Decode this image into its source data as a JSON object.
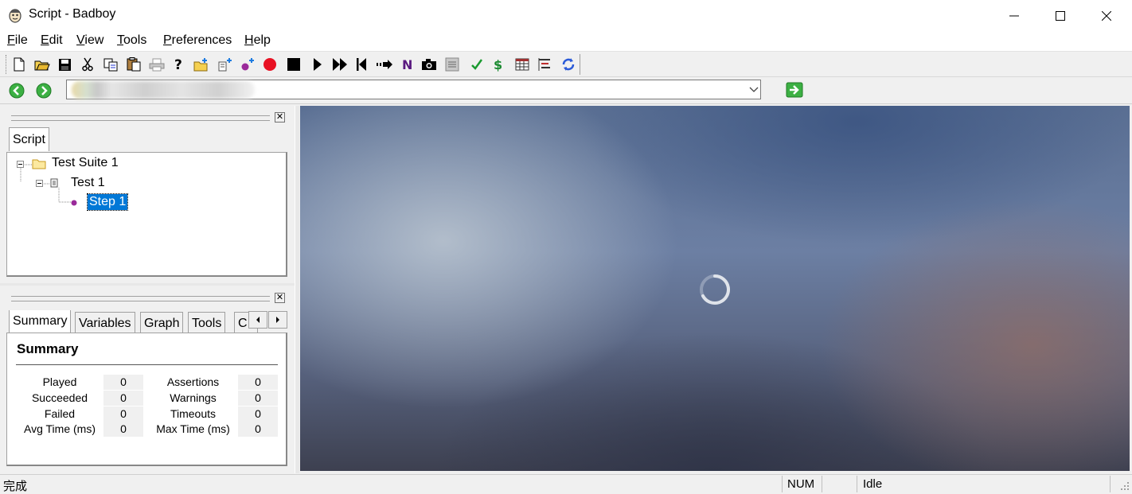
{
  "window": {
    "title": "Script - Badboy",
    "min_glyph": "—",
    "max_glyph": "☐",
    "close_glyph": "✕"
  },
  "menu": [
    {
      "key": "F",
      "rest": "ile"
    },
    {
      "key": "E",
      "rest": "dit"
    },
    {
      "key": "V",
      "rest": "iew"
    },
    {
      "key": "T",
      "rest": "ools"
    },
    {
      "key": "P",
      "rest": "references"
    },
    {
      "key": "H",
      "rest": "elp"
    }
  ],
  "toolbar": {
    "icons": [
      "new-icon",
      "open-icon",
      "save-icon",
      "cut-icon",
      "copy-icon",
      "paste-icon",
      "print-icon",
      "help-icon",
      "add-folder-icon",
      "add-test-icon",
      "add-step-icon",
      "record-icon",
      "stop-icon",
      "play-icon",
      "play-all-icon",
      "rewind-icon",
      "skip-icon",
      "navigate-icon",
      "screenshot-icon",
      "document-icon",
      "assertion-icon",
      "variable-icon",
      "table-icon",
      "tree-icon",
      "refresh-icon"
    ]
  },
  "address": {
    "value": ""
  },
  "script_pane": {
    "tab": "Script",
    "tree": {
      "suite": "Test Suite 1",
      "test": "Test 1",
      "step": "Step 1"
    }
  },
  "summary_pane": {
    "tabs": [
      "Summary",
      "Variables",
      "Graph",
      "Tools",
      "C"
    ],
    "heading": "Summary",
    "rows": [
      {
        "l1": "Played",
        "v1": "0",
        "l2": "Assertions",
        "v2": "0"
      },
      {
        "l1": "Succeeded",
        "v1": "0",
        "l2": "Warnings",
        "v2": "0"
      },
      {
        "l1": "Failed",
        "v1": "0",
        "l2": "Timeouts",
        "v2": "0"
      },
      {
        "l1": "Avg Time (ms)",
        "v1": "0",
        "l2": "Max Time (ms)",
        "v2": "0"
      }
    ]
  },
  "status": {
    "text": "完成",
    "num": "NUM",
    "state": "Idle"
  },
  "colors": {
    "accent_selection": "#0078d7",
    "record_red": "#e81123",
    "go_green": "#3cb043"
  }
}
